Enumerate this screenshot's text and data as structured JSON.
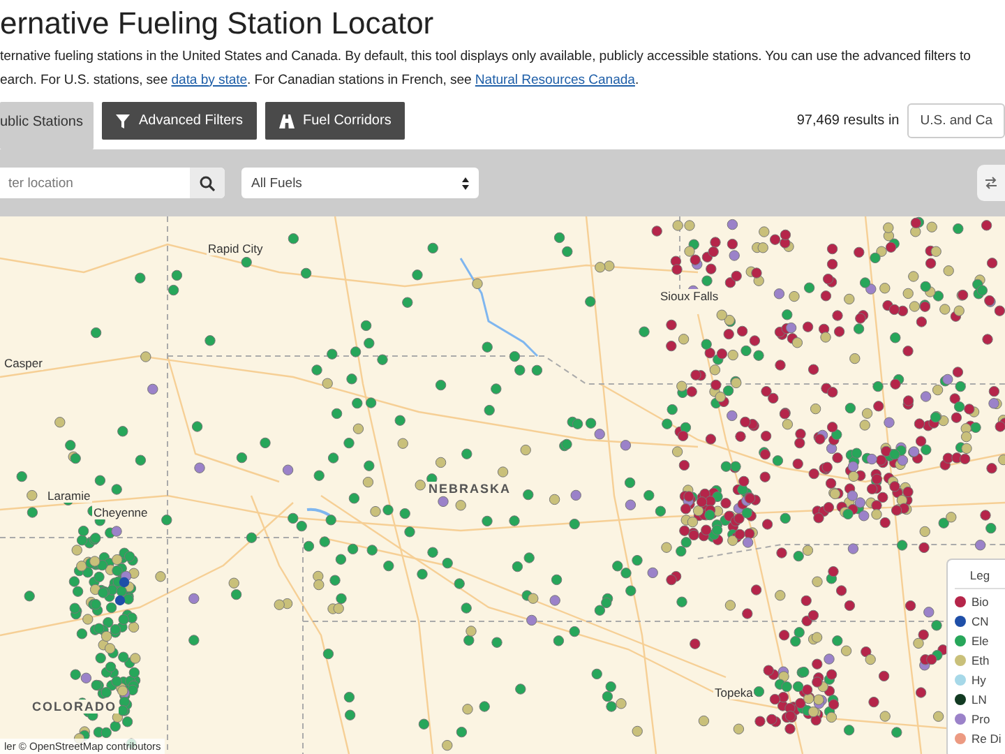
{
  "title": "ernative Fueling Station Locator",
  "description": {
    "line_1": "ternative fueling stations in the United States and Canada. By default, this tool displays only available, publicly accessible stations. You can use the advanced filters to",
    "line_2": [
      {
        "kind": "text",
        "text": "earch. For U.S. stations, see "
      },
      {
        "kind": "link",
        "text": "data by state"
      },
      {
        "kind": "text",
        "text": ". For Canadian stations in French, see "
      },
      {
        "kind": "link",
        "text": "Natural Resources Canada"
      },
      {
        "kind": "text",
        "text": "."
      }
    ]
  },
  "tabs": [
    {
      "label": "ublic Stations",
      "kind": "plain",
      "selected": true
    },
    {
      "label": "Advanced Filters",
      "kind": "filter",
      "selected": false
    },
    {
      "label": "Fuel Corridors",
      "kind": "road",
      "selected": false
    }
  ],
  "results": {
    "count": "97,469 results in",
    "region": "U.S. and Ca"
  },
  "search": {
    "placeholder": "ter location"
  },
  "fuel_select": {
    "value": "All Fuels"
  },
  "map": {
    "labels": [
      {
        "text": "Rapid City",
        "kind": "city"
      },
      {
        "text": "Sioux Falls",
        "kind": "city"
      },
      {
        "text": "Casper",
        "kind": "city"
      },
      {
        "text": "NEBRASKA",
        "kind": "state"
      },
      {
        "text": "Laramie",
        "kind": "city"
      },
      {
        "text": "Cheyenne",
        "kind": "city"
      },
      {
        "text": "COLORADO",
        "kind": "state"
      },
      {
        "text": "Topeka",
        "kind": "city"
      }
    ],
    "attribution": "ler © OpenStreetMap contributors",
    "legend": {
      "title": "Leg",
      "items": [
        {
          "label": "Bio",
          "color": "#b5254a"
        },
        {
          "label": "CN",
          "color": "#1f4fa8"
        },
        {
          "label": "Ele",
          "color": "#27a65a"
        },
        {
          "label": "Eth",
          "color": "#c9c07a"
        },
        {
          "label": "Hy",
          "color": "#a6d8e8"
        },
        {
          "label": "LN",
          "color": "#123a22"
        },
        {
          "label": "Pro",
          "color": "#9b82c9"
        },
        {
          "label": "Re Di",
          "color": "#ec9a82"
        }
      ]
    }
  }
}
